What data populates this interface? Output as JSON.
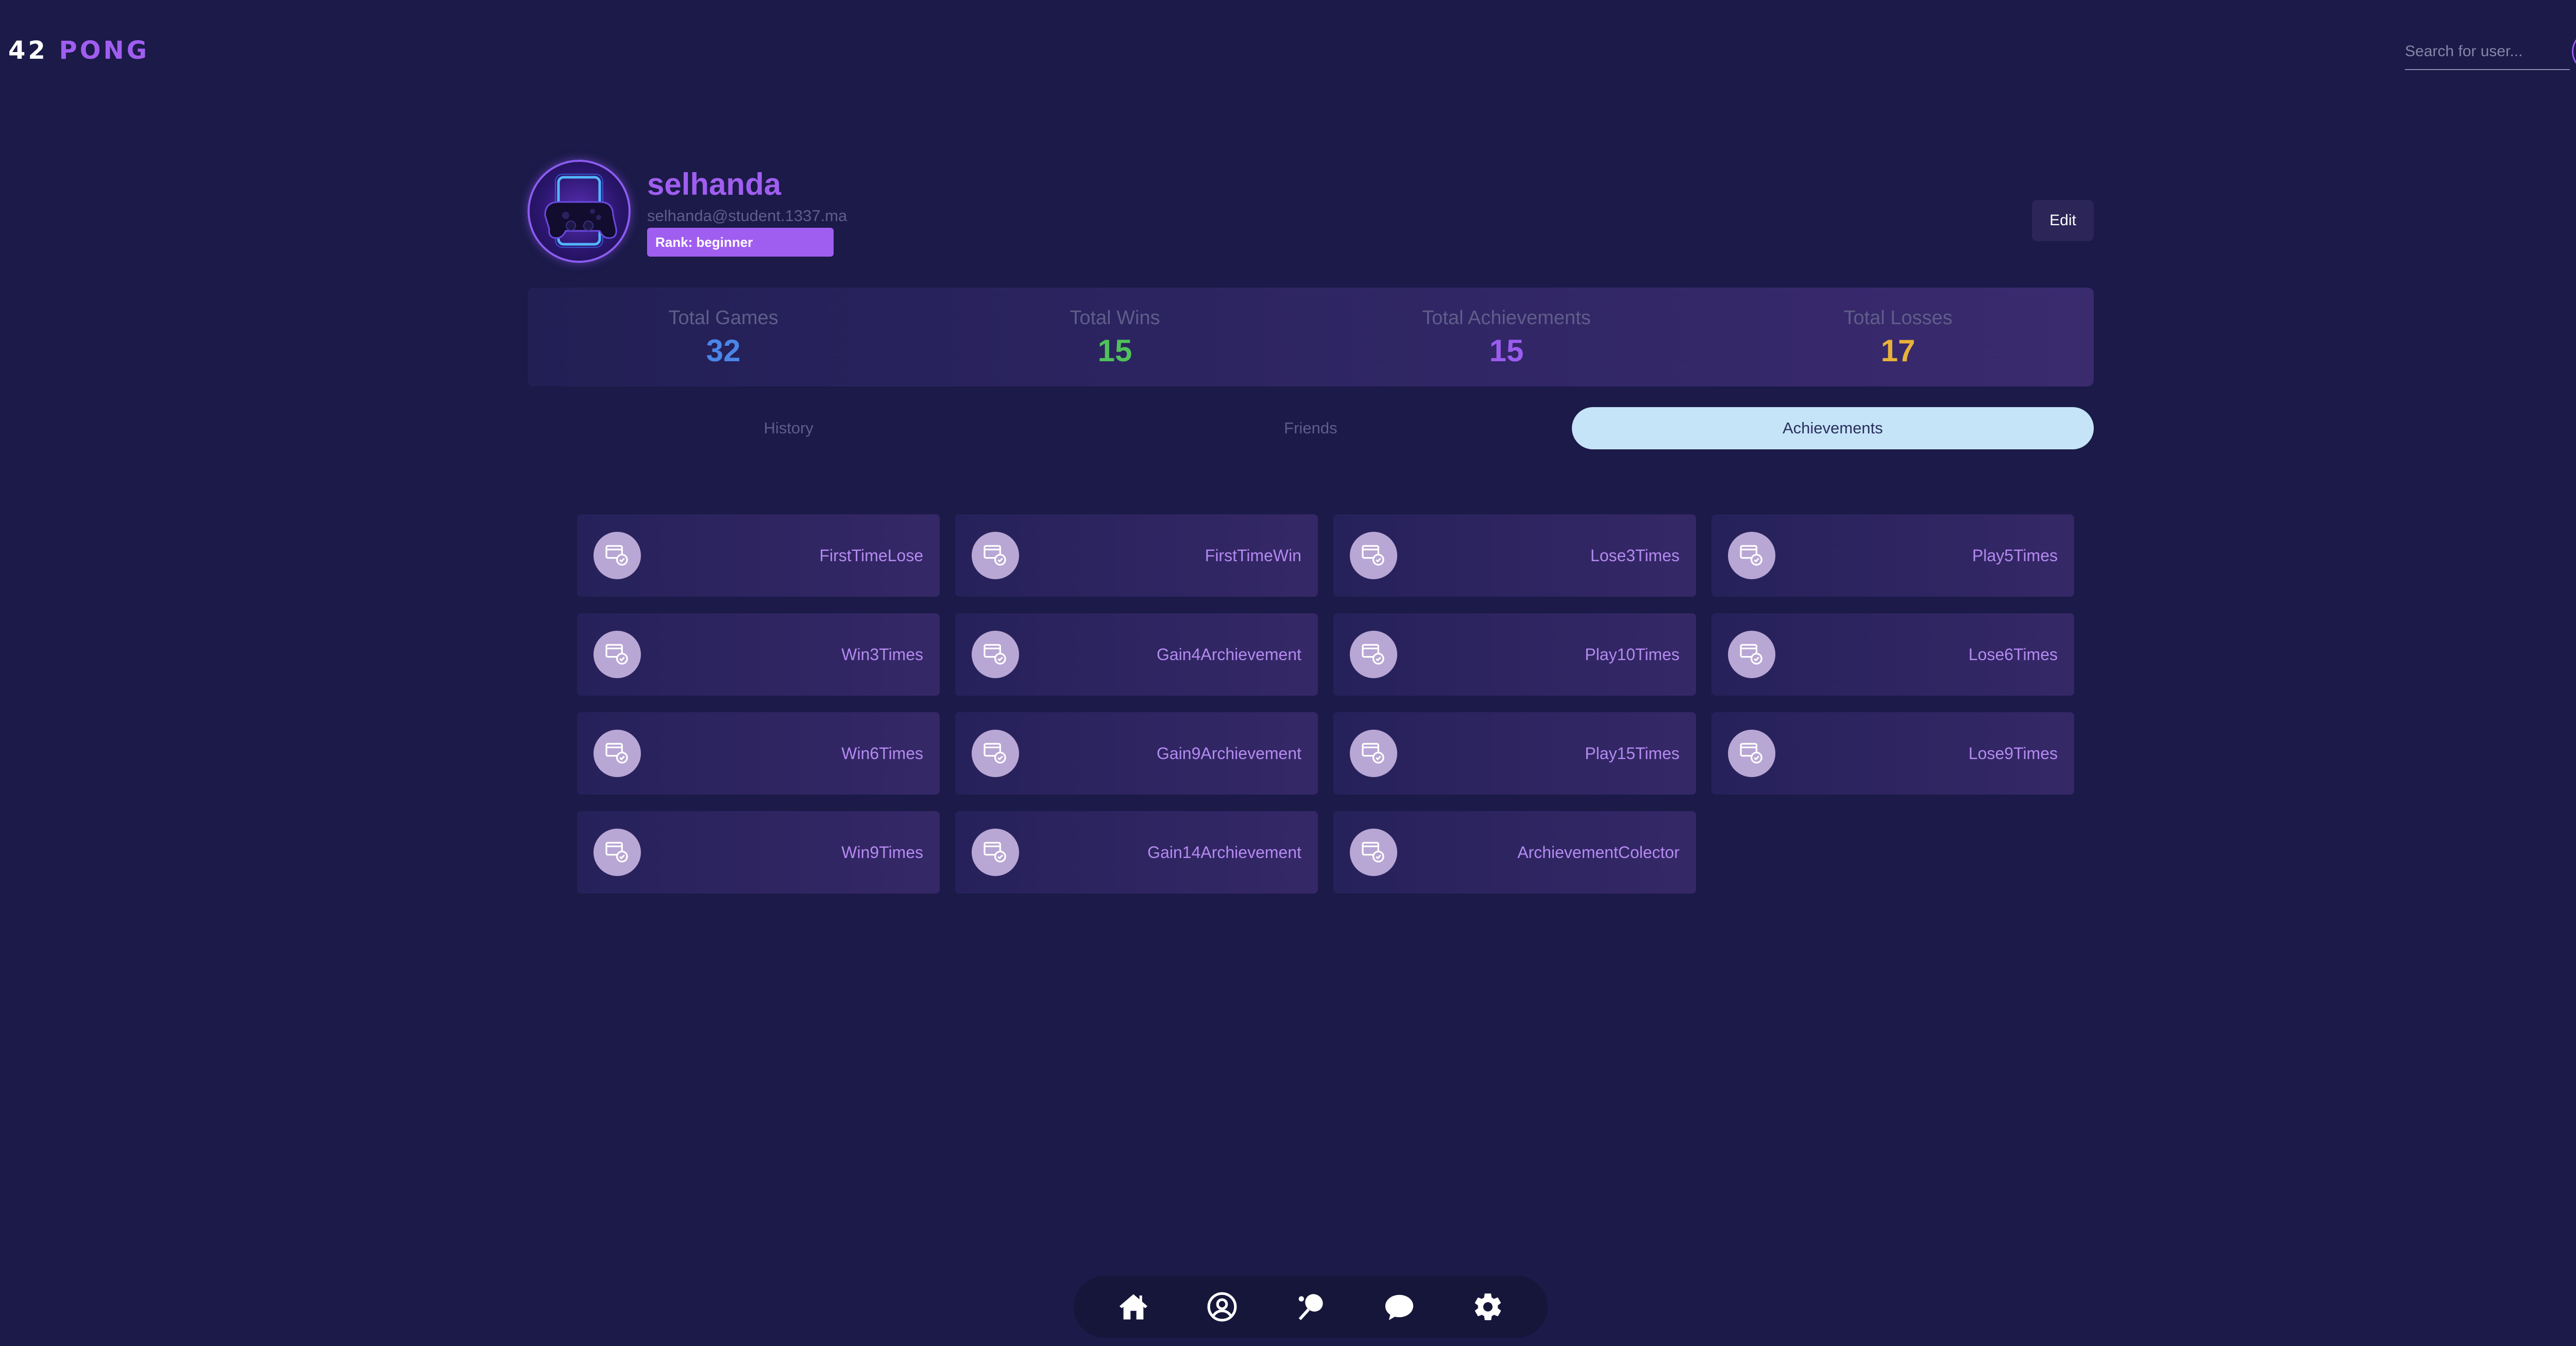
{
  "app": {
    "logo_num": "42",
    "logo_word": "PONG"
  },
  "search": {
    "placeholder": "Search for user..."
  },
  "profile": {
    "username": "selhanda",
    "email": "selhanda@student.1337.ma",
    "rank": "Rank: beginner",
    "edit_label": "Edit"
  },
  "stats": [
    {
      "label": "Total Games",
      "value": "32",
      "color": "#4a86e8"
    },
    {
      "label": "Total Wins",
      "value": "15",
      "color": "#4fc25a"
    },
    {
      "label": "Total Achievements",
      "value": "15",
      "color": "#9b5cf0"
    },
    {
      "label": "Total Losses",
      "value": "17",
      "color": "#e8b13a"
    }
  ],
  "tabs": [
    {
      "label": "History",
      "active": false
    },
    {
      "label": "Friends",
      "active": false
    },
    {
      "label": "Achievements",
      "active": true
    }
  ],
  "achievements": [
    {
      "label": "FirstTimeLose"
    },
    {
      "label": "FirstTimeWin"
    },
    {
      "label": "Lose3Times"
    },
    {
      "label": "Play5Times"
    },
    {
      "label": "Win3Times"
    },
    {
      "label": "Gain4Archievement"
    },
    {
      "label": "Play10Times"
    },
    {
      "label": "Lose6Times"
    },
    {
      "label": "Win6Times"
    },
    {
      "label": "Gain9Archievement"
    },
    {
      "label": "Play15Times"
    },
    {
      "label": "Lose9Times"
    },
    {
      "label": "Win9Times"
    },
    {
      "label": "Gain14Archievement"
    },
    {
      "label": "ArchievementColector"
    }
  ],
  "bottom_nav": [
    {
      "icon": "home-icon"
    },
    {
      "icon": "profile-icon"
    },
    {
      "icon": "ping-pong-icon"
    },
    {
      "icon": "chat-icon"
    },
    {
      "icon": "settings-icon"
    }
  ]
}
